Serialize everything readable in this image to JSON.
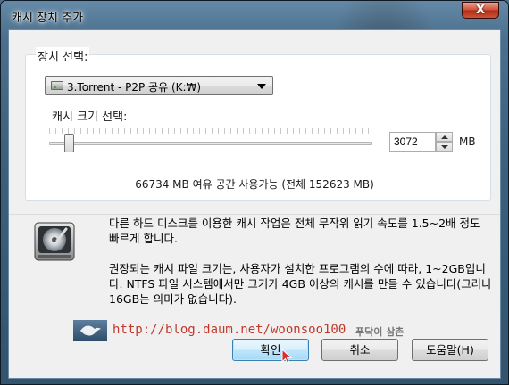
{
  "window": {
    "title": "캐시 장치 추가",
    "close_glyph": "X"
  },
  "device_group": {
    "label": "장치 선택:",
    "selected": "3.Torrent - P2P 공유 (K:₩)"
  },
  "cache_size": {
    "label": "캐시 크기 선택:",
    "value": "3072",
    "unit": "MB",
    "slider_fraction": 0.05
  },
  "free_space_text": "66734 MB 여유 공간 사용가능 (전체 152623 MB)",
  "description": {
    "para1": "다른 하드 디스크를 이용한 캐시 작업은 전체 무작위 읽기 속도를 1.5~2배 정도 빠르게 합니다.",
    "para2": "권장되는 캐시 파일 크기는, 사용자가 설치한 프로그램의 수에 따라, 1~2GB입니다. NTFS 파일 시스템에서만 크기가 4GB 이상의 캐시를 만들 수 있습니다(그러나 16GB는 의미가 없습니다)."
  },
  "watermark": {
    "url": "http://blog.daum.net/woonsoo100",
    "author": "푸닥이 삼촌"
  },
  "buttons": {
    "ok": "확인",
    "cancel": "취소",
    "help": "도움말(H)"
  },
  "icons": [
    "close-icon",
    "drive-icon",
    "dropdown-arrow-icon",
    "spin-up-icon",
    "spin-down-icon",
    "hard-disk-icon",
    "bird-logo-icon",
    "mouse-cursor-icon"
  ],
  "colors": {
    "accent": "#3c7fb1",
    "close_button": "#c8553a",
    "watermark_url": "#c0392b"
  }
}
